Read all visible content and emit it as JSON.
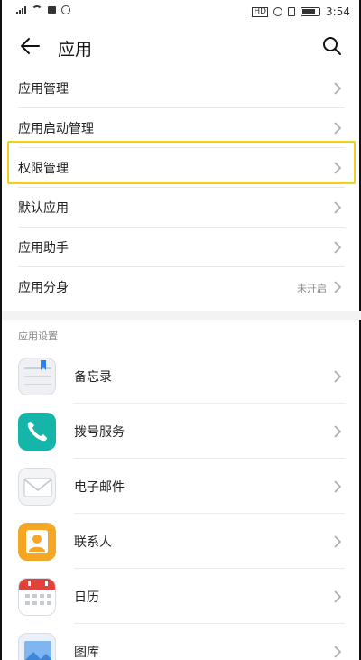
{
  "status_bar": {
    "network": "4G",
    "time": "3:54",
    "hd_label": "HD"
  },
  "header": {
    "title": "应用"
  },
  "menu_items": [
    {
      "label": "应用管理",
      "value": ""
    },
    {
      "label": "应用启动管理",
      "value": ""
    },
    {
      "label": "权限管理",
      "value": "",
      "highlighted": true
    },
    {
      "label": "默认应用",
      "value": ""
    },
    {
      "label": "应用助手",
      "value": ""
    },
    {
      "label": "应用分身",
      "value": "未开启"
    }
  ],
  "section": {
    "title": "应用设置"
  },
  "apps": [
    {
      "name": "备忘录",
      "icon": "memo-icon"
    },
    {
      "name": "拨号服务",
      "icon": "phone-icon"
    },
    {
      "name": "电子邮件",
      "icon": "mail-icon"
    },
    {
      "name": "联系人",
      "icon": "contacts-icon"
    },
    {
      "name": "日历",
      "icon": "calendar-icon"
    },
    {
      "name": "图库",
      "icon": "gallery-icon"
    }
  ],
  "colors": {
    "highlight": "#f2cf1a",
    "phone_icon": "#16b5aa",
    "contacts_icon": "#f5a623",
    "calendar_accent": "#e2423a",
    "memo_bookmark": "#2f7fe6"
  }
}
